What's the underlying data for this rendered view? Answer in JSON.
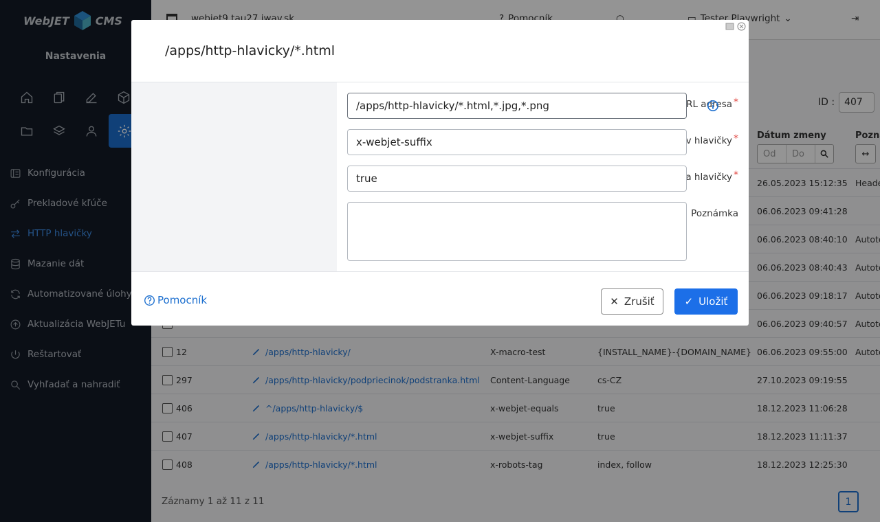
{
  "app": {
    "logo_text": "WebJET CMS",
    "section_title": "Nastavenia"
  },
  "sidebar": {
    "menu": [
      {
        "label": "Konfigurácia",
        "icon": "list-icon"
      },
      {
        "label": "Prekladové kľúče",
        "icon": "key-icon"
      },
      {
        "label": "HTTP hlavičky",
        "icon": "arrows-icon",
        "active": true
      },
      {
        "label": "Mazanie dát",
        "icon": "database-icon"
      },
      {
        "label": "Automatizované úlohy",
        "icon": "refresh-icon"
      },
      {
        "label": "Aktualizácia WebJETu",
        "icon": "upload-icon"
      },
      {
        "label": "Reštartovať",
        "icon": "power-icon"
      },
      {
        "label": "Vyhľadať a nahradiť",
        "icon": "search-icon"
      }
    ]
  },
  "topbar": {
    "domain": "webjet9.tau27.iway.sk",
    "help": "Pomocník",
    "user": "Tester Playwright"
  },
  "table": {
    "id_label": "ID :",
    "id_value": "407",
    "col_date": "Dátum zmeny",
    "col_note": "Poznám",
    "filter_from": "Od",
    "filter_to": "Do",
    "rows": [
      {
        "id": "",
        "url": "",
        "name": "",
        "value": "",
        "date": "26.05.2023 15:12:35",
        "note": "Heade"
      },
      {
        "id": "",
        "url": "",
        "name": "",
        "value": "",
        "date": "06.06.2023 09:41:28",
        "note": ""
      },
      {
        "id": "",
        "url": "",
        "name": "",
        "value": "",
        "date": "06.06.2023 08:40:10",
        "note": "Autote"
      },
      {
        "id": "",
        "url": "",
        "name": "",
        "value": "",
        "date": "06.06.2023 08:40:43",
        "note": "Autote"
      },
      {
        "id": "",
        "url": "",
        "name": "",
        "value": "",
        "date": "06.06.2023 09:18:17",
        "note": "Autote"
      },
      {
        "id": "",
        "url": "",
        "name": "",
        "value": "",
        "date": "06.06.2023 09:40:57",
        "note": "Autote"
      },
      {
        "id": "12",
        "url": "/apps/http-hlavicky/",
        "name": "X-macro-test",
        "value": "{INSTALL_NAME}-{DOMAIN_NAME}",
        "date": "06.06.2023 09:55:00",
        "note": "Autote"
      },
      {
        "id": "297",
        "url": "/apps/http-hlavicky/podpriecinok/podstranka.html",
        "name": "Content-Language",
        "value": "cs-CZ",
        "date": "27.10.2023 09:19:55",
        "note": ""
      },
      {
        "id": "406",
        "url": "^/apps/http-hlavicky/$",
        "name": "x-webjet-equals",
        "value": "true",
        "date": "18.12.2023 11:06:28",
        "note": ""
      },
      {
        "id": "407",
        "url": "/apps/http-hlavicky/*.html",
        "name": "x-webjet-suffix",
        "value": "true",
        "date": "18.12.2023 11:11:37",
        "note": ""
      },
      {
        "id": "408",
        "url": "/apps/http-hlavicky/*.html",
        "name": "x-robots-tag",
        "value": "index, follow",
        "date": "18.12.2023 12:25:30",
        "note": ""
      }
    ],
    "footer": "Záznamy 1 až 11 z 11",
    "page": "1"
  },
  "modal": {
    "title": "/apps/http-hlavicky/*.html",
    "fields": {
      "url_label": "URL adresa",
      "url_value": "/apps/http-hlavicky/*.html,*.jpg,*.png",
      "name_label": "Názov hlavičky",
      "name_value": "x-webjet-suffix",
      "value_label": "Hodnota hlavičky",
      "value_value": "true",
      "note_label": "Poznámka",
      "note_value": ""
    },
    "required_mark": "*",
    "help": "Pomocník",
    "cancel": "Zrušiť",
    "save": "Uložiť"
  },
  "colors": {
    "accent": "#1c6fcf",
    "sidebar_bg": "#131a26",
    "required": "#e0443e"
  }
}
